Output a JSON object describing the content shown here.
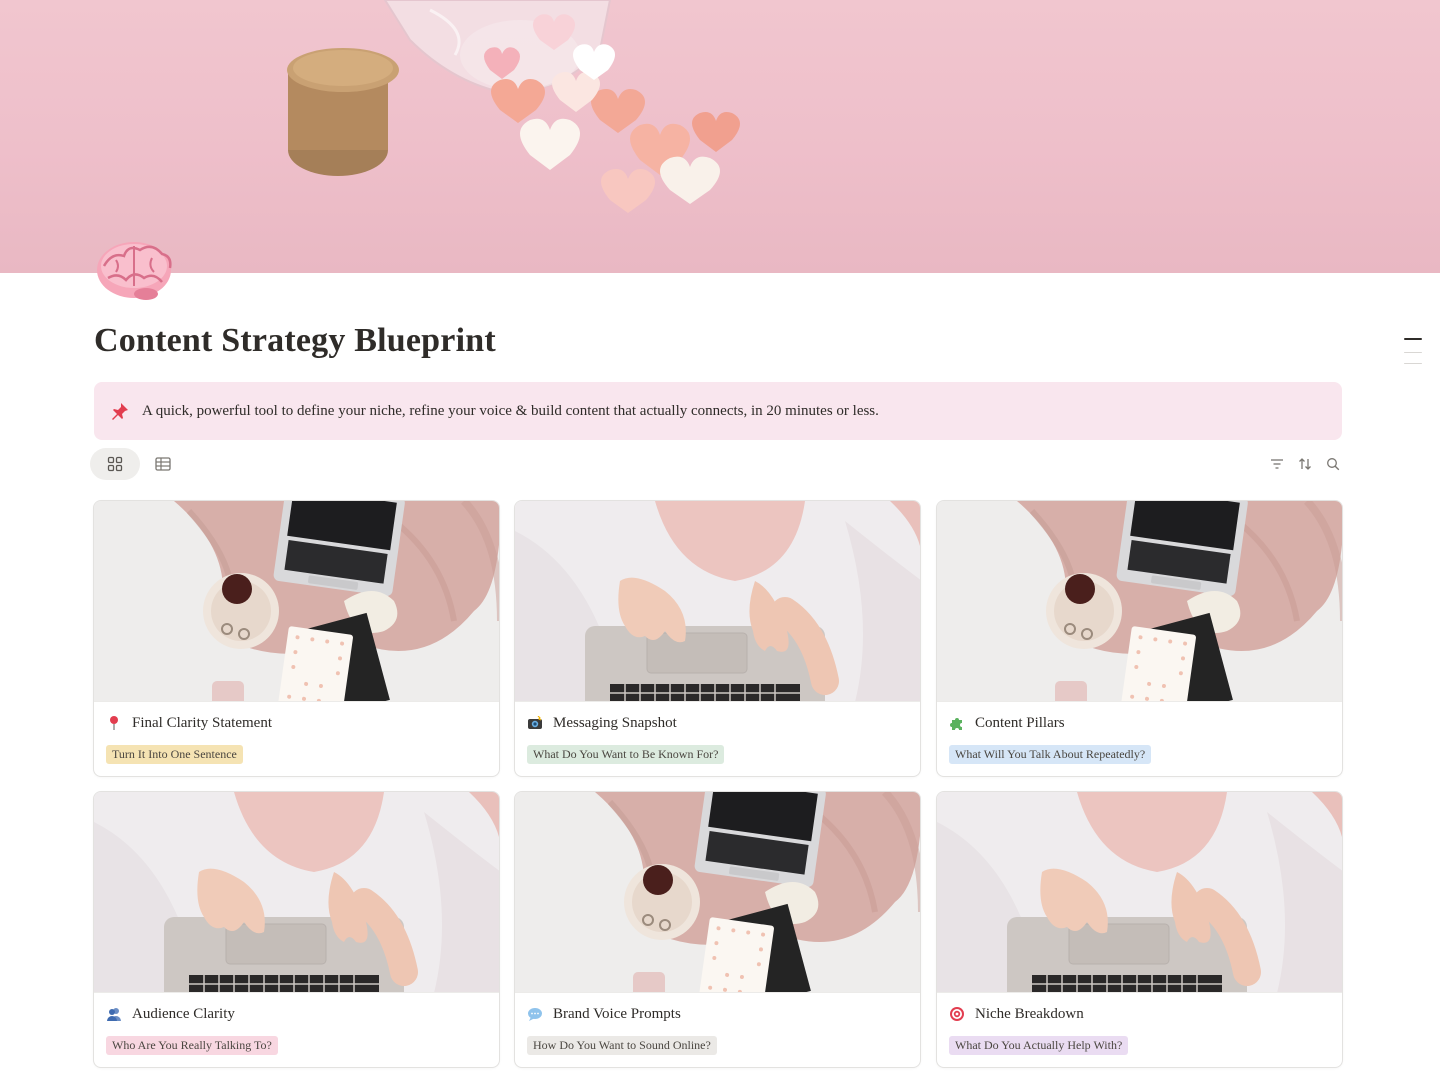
{
  "page": {
    "title": "Content Strategy Blueprint",
    "icon": "brain-icon",
    "cover": "pink-hearts-jar-cover"
  },
  "callout": {
    "icon": "pushpin-icon",
    "text": "A quick, powerful tool to define your niche, refine your voice & build content that actually connects, in 20 minutes or less."
  },
  "views": [
    {
      "name": "gallery",
      "icon": "gallery-view-icon",
      "active": true
    },
    {
      "name": "table",
      "icon": "table-view-icon",
      "active": false
    }
  ],
  "toolbar": [
    "filter-icon",
    "sort-icon",
    "search-icon"
  ],
  "cards": [
    {
      "title": "Final Clarity Statement",
      "icon": "round-pushpin-icon",
      "tag": "Turn It Into One Sentence",
      "tag_color": "#f5e3b3",
      "photo": "flatlay"
    },
    {
      "title": "Messaging Snapshot",
      "icon": "camera-flash-icon",
      "tag": "What Do You Want to Be Known For?",
      "tag_color": "#dcebdf",
      "photo": "typing"
    },
    {
      "title": "Content Pillars",
      "icon": "puzzle-piece-icon",
      "tag": "What Will You Talk About Repeatedly?",
      "tag_color": "#d6e6f7",
      "photo": "flatlay"
    },
    {
      "title": "Audience Clarity",
      "icon": "people-icon",
      "tag": "Who Are You Really Talking To?",
      "tag_color": "#f8d7e1",
      "photo": "typing"
    },
    {
      "title": "Brand Voice Prompts",
      "icon": "speech-bubble-icon",
      "tag": "How Do You Want to Sound Online?",
      "tag_color": "#ebe9e6",
      "photo": "flatlay"
    },
    {
      "title": "Niche Breakdown",
      "icon": "target-icon",
      "tag": "What Do You Actually Help With?",
      "tag_color": "#eadcf2",
      "photo": "typing"
    }
  ]
}
